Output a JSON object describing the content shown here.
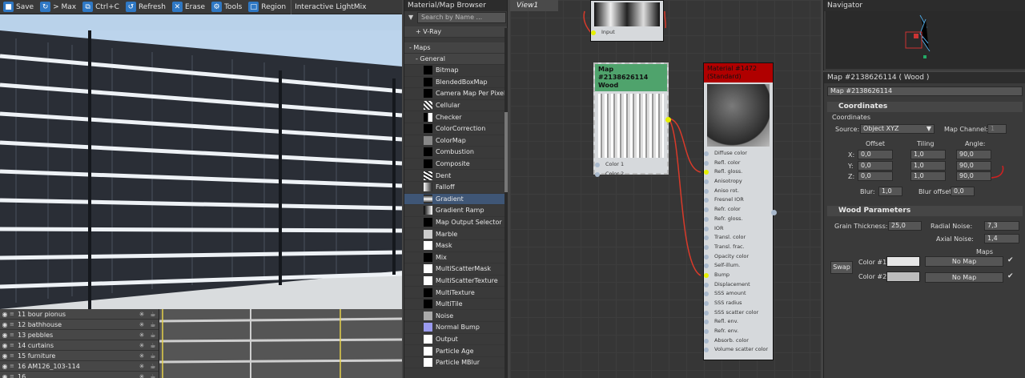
{
  "toolbar": {
    "save": "Save",
    "max": "> Max",
    "copy": "Ctrl+C",
    "refresh": "Refresh",
    "erase": "Erase",
    "tools": "Tools",
    "region": "Region",
    "lightmix": "Interactive LightMix"
  },
  "layers": [
    {
      "name": "11 bour pionus"
    },
    {
      "name": "12 bathhouse"
    },
    {
      "name": "13 pebbles"
    },
    {
      "name": "14 curtains"
    },
    {
      "name": "15 furniture"
    },
    {
      "name": "16 AM126_103-114"
    },
    {
      "name": "16 ..."
    }
  ],
  "browser": {
    "title": "Material/Map Browser",
    "search_placeholder": "Search by Name ...",
    "vray": "+ V-Ray",
    "maps": "- Maps",
    "general": "- General",
    "items": [
      "Bitmap",
      "BlendedBoxMap",
      "Camera Map Per Pixel",
      "Cellular",
      "Checker",
      "ColorCorrection",
      "ColorMap",
      "Combustion",
      "Composite",
      "Dent",
      "Falloff",
      "Gradient",
      "Gradient Ramp",
      "Map Output Selector",
      "Marble",
      "Mask",
      "Mix",
      "MultiScatterMask",
      "MultiScatterTexture",
      "MultiTexture",
      "MultiTile",
      "Noise",
      "Normal Bump",
      "Output",
      "Particle Age",
      "Particle MBlur"
    ],
    "selected": "Gradient"
  },
  "view1": {
    "tab": "View1",
    "top_node": {
      "port": "Input"
    },
    "map_node": {
      "title": "Map #2138626114",
      "subtitle": "Wood",
      "ports": [
        "Color 1",
        "Color 2"
      ]
    },
    "mat_node": {
      "title": "Material #1472",
      "subtitle": "(Standard)",
      "ports": [
        "Diffuse color",
        "Refl. color",
        "Refl. gloss.",
        "Anisotropy",
        "Aniso rot.",
        "Fresnel IOR",
        "Refr. color",
        "Refr. gloss.",
        "IOR",
        "Transl. color",
        "Transl. frac.",
        "Opacity color",
        "Self-illum.",
        "Bump",
        "Displacement",
        "SSS amount",
        "SSS radius",
        "SSS scatter color",
        "Refl. env.",
        "Refr. env.",
        "Absorb. color",
        "Volume scatter color"
      ],
      "active": [
        "Refl. gloss.",
        "Bump"
      ]
    }
  },
  "navigator": {
    "title": "Navigator"
  },
  "params": {
    "title": "Map #2138626114  ( Wood )",
    "name": "Map #2138626114",
    "coords": {
      "section": "Coordinates",
      "group": "Coordinates",
      "source_label": "Source:",
      "source": "Object XYZ",
      "channel_label": "Map Channel:",
      "channel": "1",
      "offset_h": "Offset",
      "tiling_h": "Tiling",
      "angle_h": "Angle:",
      "rows": [
        {
          "axis": "X:",
          "offset": "0,0",
          "tiling": "1,0",
          "angle": "90,0"
        },
        {
          "axis": "Y:",
          "offset": "0,0",
          "tiling": "1,0",
          "angle": "90,0"
        },
        {
          "axis": "Z:",
          "offset": "0,0",
          "tiling": "1,0",
          "angle": "90,0"
        }
      ],
      "blur_label": "Blur:",
      "blur": "1,0",
      "bluroff_label": "Blur offset:",
      "bluroff": "0,0"
    },
    "wood": {
      "section": "Wood Parameters",
      "grain_label": "Grain Thickness:",
      "grain": "25,0",
      "radial_label": "Radial Noise:",
      "radial": "7,3",
      "axial_label": "Axial Noise:",
      "axial": "1,4",
      "maps_h": "Maps",
      "swap": "Swap",
      "color1_label": "Color #1",
      "color2_label": "Color #2",
      "nomap": "No Map"
    }
  },
  "colors": {
    "map_header": "#4fa36c",
    "mat_header": "#b00000",
    "accent": "#2f78c4",
    "wire": "#d93a2a"
  }
}
